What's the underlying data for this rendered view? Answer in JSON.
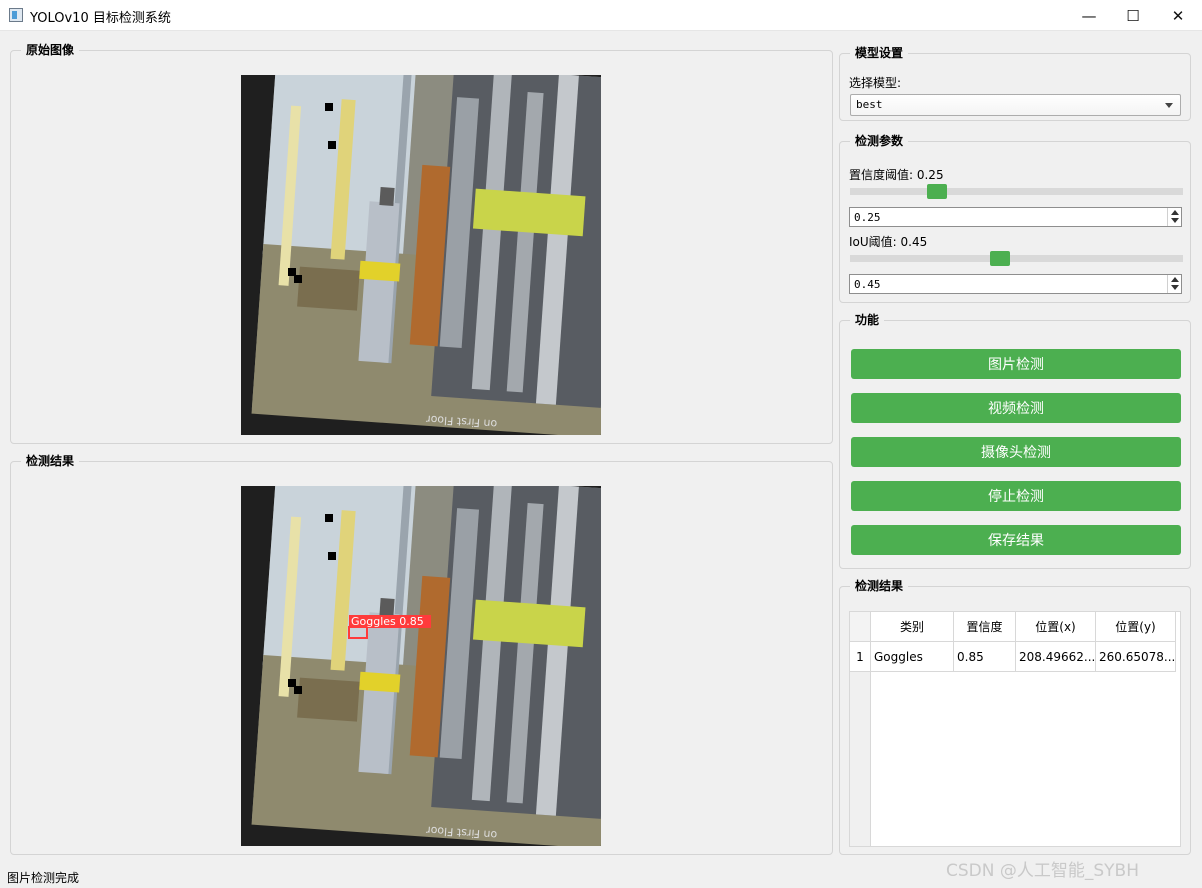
{
  "window": {
    "title": "YOLOv10 目标检测系统",
    "minimize_symbol": "—",
    "maximize_symbol": "☐",
    "close_symbol": "✕"
  },
  "panels": {
    "original_title": "原始图像",
    "result_title": "检测结果",
    "image_caption": "on First Floor"
  },
  "detection_overlay": {
    "label": "Goggles",
    "confidence": "0.85",
    "box_color": "#ff3b3b"
  },
  "model_settings": {
    "title": "模型设置",
    "select_label": "选择模型:",
    "selected_model": "best"
  },
  "params": {
    "title": "检测参数",
    "confidence_label": "置信度阈值: 0.25",
    "confidence_value": "0.25",
    "confidence_fraction": 0.25,
    "iou_label": "IoU阈值: 0.45",
    "iou_value": "0.45",
    "iou_fraction": 0.45,
    "accent_color": "#4caf50"
  },
  "functions": {
    "title": "功能",
    "buttons": [
      "图片检测",
      "视频检测",
      "摄像头检测",
      "停止检测",
      "保存结果"
    ]
  },
  "results": {
    "title": "检测结果",
    "columns": [
      "类别",
      "置信度",
      "位置(x)",
      "位置(y)"
    ],
    "rows": [
      {
        "index": "1",
        "class": "Goggles",
        "confidence": "0.85",
        "x": "208.49662...",
        "y": "260.65078..."
      }
    ]
  },
  "status": {
    "text": "图片检测完成"
  },
  "watermark": "CSDN @人工智能_SYBH"
}
